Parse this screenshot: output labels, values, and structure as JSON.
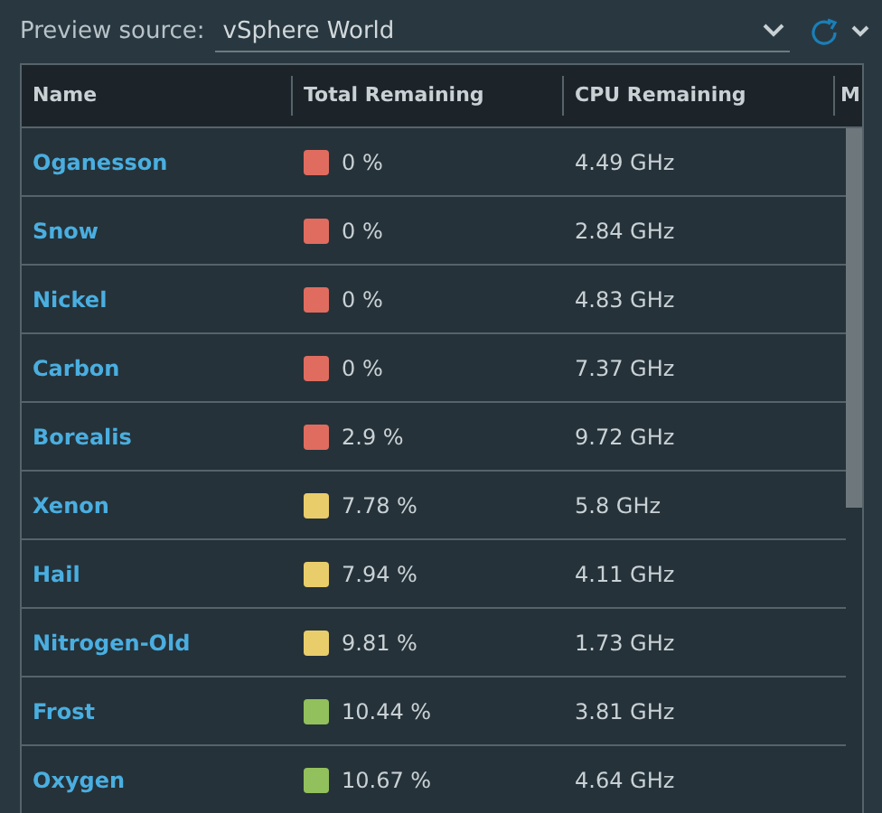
{
  "preview": {
    "label": "Preview source:",
    "value": "vSphere World"
  },
  "table": {
    "columns": [
      "Name",
      "Total Remaining",
      "CPU Remaining",
      "M"
    ],
    "rows": [
      {
        "name": "Oganesson",
        "total": "0 %",
        "color": "#e06c5f",
        "cpu": "4.49 GHz"
      },
      {
        "name": "Snow",
        "total": "0 %",
        "color": "#e06c5f",
        "cpu": "2.84 GHz"
      },
      {
        "name": "Nickel",
        "total": "0 %",
        "color": "#e06c5f",
        "cpu": "4.83 GHz"
      },
      {
        "name": "Carbon",
        "total": "0 %",
        "color": "#e06c5f",
        "cpu": "7.37 GHz"
      },
      {
        "name": "Borealis",
        "total": "2.9 %",
        "color": "#e06c5f",
        "cpu": "9.72 GHz"
      },
      {
        "name": "Xenon",
        "total": "7.78 %",
        "color": "#e9cd6b",
        "cpu": "5.8 GHz"
      },
      {
        "name": "Hail",
        "total": "7.94 %",
        "color": "#e9cd6b",
        "cpu": "4.11 GHz"
      },
      {
        "name": "Nitrogen-Old",
        "total": "9.81 %",
        "color": "#e9cd6b",
        "cpu": "1.73 GHz"
      },
      {
        "name": "Frost",
        "total": "10.44 %",
        "color": "#92c05c",
        "cpu": "3.81 GHz"
      },
      {
        "name": "Oxygen",
        "total": "10.67 %",
        "color": "#92c05c",
        "cpu": "4.64 GHz"
      }
    ]
  }
}
